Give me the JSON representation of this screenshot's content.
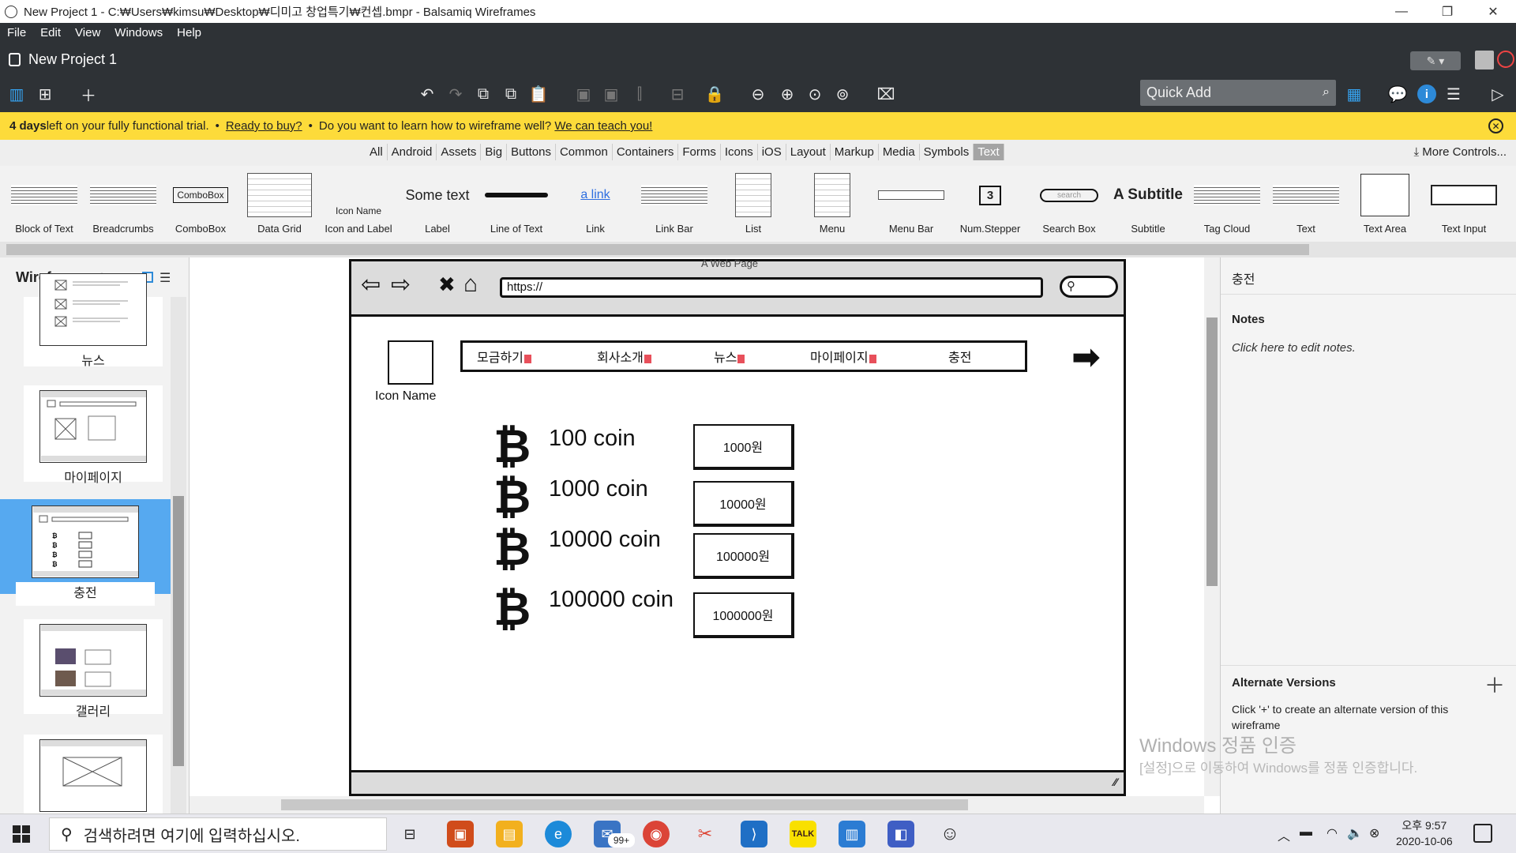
{
  "window": {
    "title": "New Project 1 - C:₩Users₩kimsu₩Desktop₩디미고 창업특기₩컨셉.bmpr - Balsamiq Wireframes",
    "controls": [
      "—",
      "❐",
      "✕"
    ]
  },
  "menu": [
    "File",
    "Edit",
    "View",
    "Windows",
    "Help"
  ],
  "project": {
    "title": "New Project 1"
  },
  "quick_add": {
    "placeholder": "Quick Add"
  },
  "banner": {
    "days": "4 days",
    "trial_text": " left on your fully functional trial.",
    "buy_link": "Ready to buy?",
    "learn_text": "Do you want to learn how to wireframe well?",
    "teach_link": "We can teach you!"
  },
  "categories": [
    "All",
    "Android",
    "Assets",
    "Big",
    "Buttons",
    "Common",
    "Containers",
    "Forms",
    "Icons",
    "iOS",
    "Layout",
    "Markup",
    "Media",
    "Symbols",
    "Text"
  ],
  "active_category": "Text",
  "more_controls": "More Controls...",
  "library": [
    {
      "label": "Block of Text",
      "icon": "block-of-text-icon"
    },
    {
      "label": "Breadcrumbs",
      "icon": "breadcrumbs-icon"
    },
    {
      "label": "ComboBox",
      "icon": "combobox-icon",
      "sample": "ComboBox"
    },
    {
      "label": "Data Grid",
      "icon": "data-grid-icon"
    },
    {
      "label": "Icon and Label",
      "icon": "icon-and-label-icon",
      "sample": "Icon Name"
    },
    {
      "label": "Label",
      "icon": "label-icon",
      "sample": "Some text"
    },
    {
      "label": "Line of Text",
      "icon": "line-of-text-icon"
    },
    {
      "label": "Link",
      "icon": "link-icon",
      "sample": "a link"
    },
    {
      "label": "Link Bar",
      "icon": "link-bar-icon"
    },
    {
      "label": "List",
      "icon": "list-icon"
    },
    {
      "label": "Menu",
      "icon": "menu-icon"
    },
    {
      "label": "Menu Bar",
      "icon": "menu-bar-icon"
    },
    {
      "label": "Num.Stepper",
      "icon": "num-stepper-icon",
      "sample": "3"
    },
    {
      "label": "Search Box",
      "icon": "search-box-icon",
      "sample": "search"
    },
    {
      "label": "Subtitle",
      "icon": "subtitle-icon",
      "sample": "A Subtitle"
    },
    {
      "label": "Tag Cloud",
      "icon": "tag-cloud-icon"
    },
    {
      "label": "Text",
      "icon": "text-icon"
    },
    {
      "label": "Text Area",
      "icon": "text-area-icon"
    },
    {
      "label": "Text Input",
      "icon": "text-input-icon"
    }
  ],
  "wireframes_panel": {
    "title": "Wireframes",
    "pages": [
      "뉴스",
      "마이페이지",
      "충전",
      "갤러리"
    ],
    "selected": "충전"
  },
  "mockup": {
    "window_title": "A Web Page",
    "url": "https://",
    "icon_label": "Icon Name",
    "nav": [
      "모금하기",
      "회사소개",
      "뉴스",
      "마이페이지",
      "충전"
    ],
    "coins": [
      {
        "label": "100 coin",
        "price": "1000원"
      },
      {
        "label": "1000 coin",
        "price": "10000원"
      },
      {
        "label": "10000 coin",
        "price": "100000원"
      },
      {
        "label": "100000 coin",
        "price": "1000000원"
      }
    ],
    "bitcoin_glyph": "₿"
  },
  "inspector": {
    "title": "충전",
    "notes_heading": "Notes",
    "notes_placeholder": "Click here to edit notes.",
    "alt_heading": "Alternate Versions",
    "alt_text": "Click '+' to create an alternate version of this wireframe"
  },
  "watermark": {
    "line1": "Windows 정품 인증",
    "line2": "[설정]으로 이동하여 Windows를 정품 인증합니다."
  },
  "taskbar": {
    "search_placeholder": "검색하려면 여기에 입력하십시오.",
    "mail_badge": "99+",
    "time": "오후 9:57",
    "date": "2020-10-06"
  }
}
